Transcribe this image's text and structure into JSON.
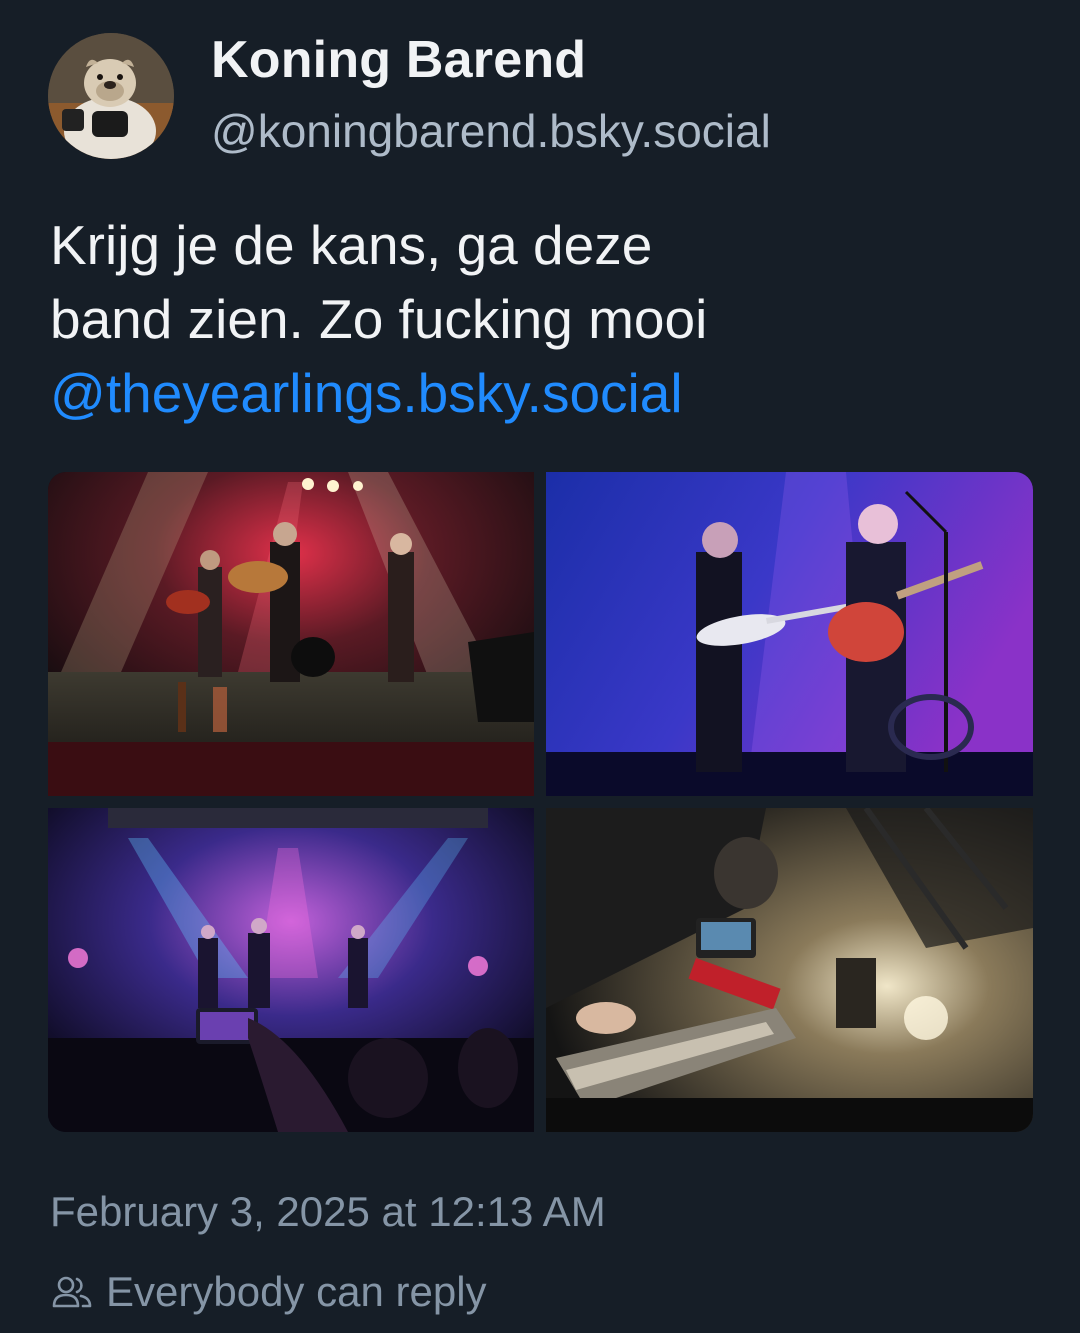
{
  "author": {
    "display_name": "Koning Barend",
    "handle": "@koningbarend.bsky.social",
    "avatar_icon": "bulldog-avatar"
  },
  "post": {
    "text_lines": [
      "Krijg je de kans, ga deze",
      "band zien. Zo fucking mooi"
    ],
    "mention": "@theyearlings.bsky.social",
    "images": [
      {
        "icon": "concert-photo-red-stage"
      },
      {
        "icon": "concert-photo-blue-guitarists"
      },
      {
        "icon": "concert-photo-purple-crowd"
      },
      {
        "icon": "concert-photo-pedal-steel"
      }
    ]
  },
  "meta": {
    "timestamp": "February 3, 2025 at 12:13 AM",
    "reply_setting": "Everybody can reply",
    "reply_icon": "people-icon"
  },
  "colors": {
    "background": "#161e27",
    "text": "#f1f3f5",
    "muted": "#8595a6",
    "handle": "#aebbc9",
    "link": "#208bfe"
  }
}
